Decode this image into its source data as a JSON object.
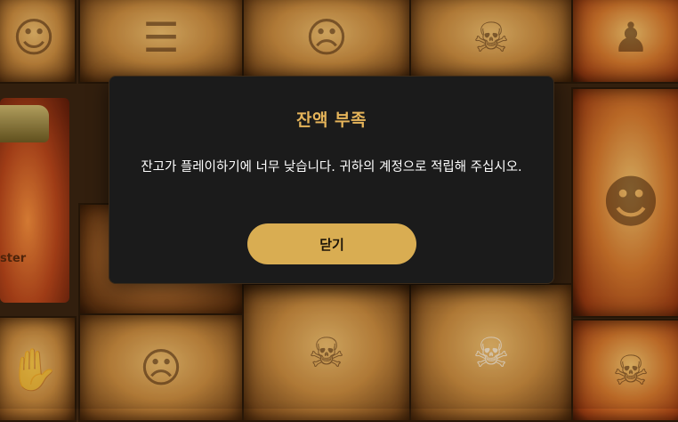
{
  "dialog": {
    "title": "잔액 부족",
    "message": "잔고가 플레이하기에 너무 낮습니다. 귀하의 계정으로 적립해 주십시오.",
    "close_label": "닫기"
  },
  "background": {
    "jar_label": "ster"
  },
  "colors": {
    "dialog_bg": "#1b1b1b",
    "accent_gold": "#d9ad52",
    "title_gold": "#e5b45a"
  }
}
